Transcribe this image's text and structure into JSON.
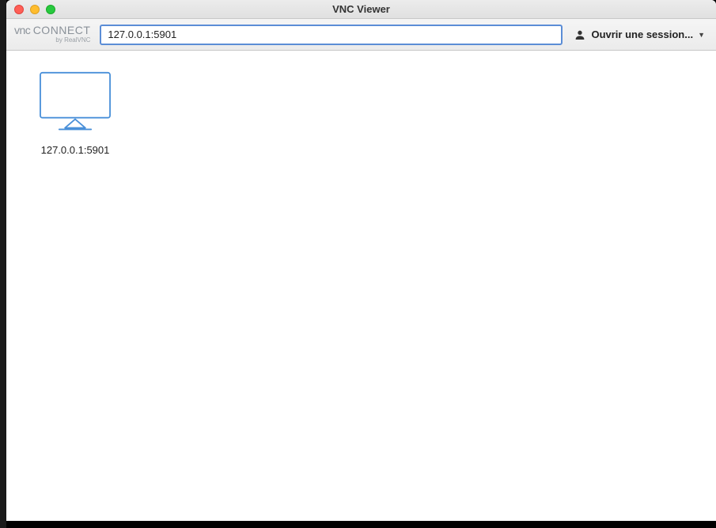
{
  "window": {
    "title": "VNC Viewer"
  },
  "logo": {
    "brand_vnc": "vnc",
    "brand_connect": "connect",
    "byline": "by RealVNC"
  },
  "toolbar": {
    "address_value": "127.0.0.1:5901",
    "session_label": "Ouvrir une session..."
  },
  "connections": [
    {
      "label": "127.0.0.1:5901"
    }
  ]
}
